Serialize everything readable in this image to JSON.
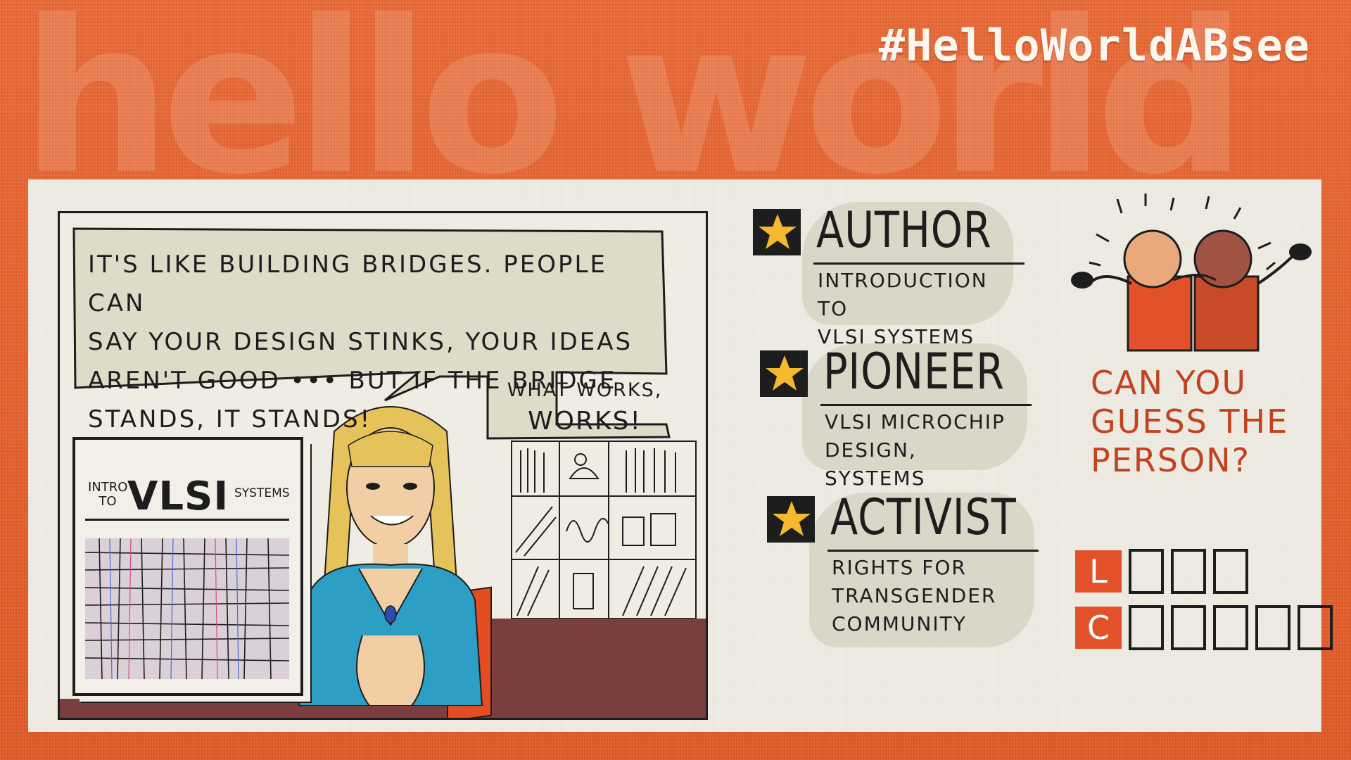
{
  "background": {
    "watermark_text": "hello world",
    "hashtag": "#HelloWorldABsee",
    "color": "#e8612f"
  },
  "comic": {
    "quote": "It's like building bridges. People can say your design stinks, your ideas aren't good ... but if the bridge stands, it stands!",
    "quote_lines": [
      "It's like building bridges. People can",
      "say your design stinks, your ideas",
      "aren't good ••• But if the bridge",
      "stands, it stands!"
    ],
    "quote2_small": "What works,",
    "quote2_big": "works!",
    "book": {
      "intro": "Intro to",
      "title": "VLSI",
      "subtitle": "Systems"
    }
  },
  "roles": [
    {
      "title": "AUTHOR",
      "sub1": "Introduction to",
      "sub2": "VLSI systems"
    },
    {
      "title": "PIONEER",
      "sub1": "VLSI microchip",
      "sub2": "design, systems"
    },
    {
      "title": "ACTIVIST",
      "sub1": "Rights for",
      "sub2": "Transgender",
      "sub3": "community"
    }
  ],
  "guess": {
    "question_lines": [
      "Can you",
      "guess the",
      "person?"
    ],
    "first_initial": "L",
    "first_blanks": 3,
    "last_initial": "C",
    "last_blanks": 5
  },
  "colors": {
    "accent": "#c2421d",
    "badge": "#e2512a",
    "star": "#f5b82e",
    "card": "#efece4"
  }
}
